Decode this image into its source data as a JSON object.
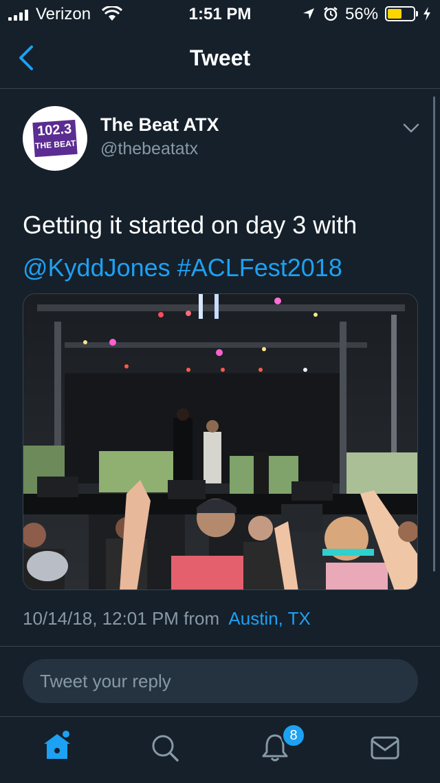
{
  "status_bar": {
    "carrier": "Verizon",
    "time": "1:51 PM",
    "battery_percent": "56%",
    "battery_level": 0.56
  },
  "nav": {
    "title": "Tweet"
  },
  "tweet": {
    "avatar_text_line1": "102.3",
    "avatar_text_line2": "THE BEAT",
    "display_name": "The Beat ATX",
    "handle": "@thebeatatx",
    "text": "Getting it started on day 3 with",
    "mention": "@KyddJones",
    "hashtag": "#ACLFest2018",
    "timestamp": "10/14/18, 12:01 PM from",
    "location": "Austin, TX"
  },
  "reply": {
    "placeholder": "Tweet your reply"
  },
  "tabbar": {
    "notification_count": "8"
  },
  "colors": {
    "background": "#15202b",
    "accent": "#1da1f2",
    "secondary_text": "#8899a6",
    "battery_fill": "#ffd500",
    "avatar_purple": "#5b2c91"
  }
}
